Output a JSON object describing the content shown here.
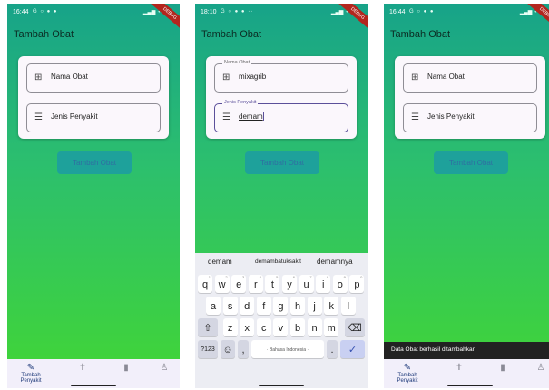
{
  "colors": {
    "accent": "#1ea19b",
    "gradient_top": "#17a389",
    "gradient_bottom": "#3fd33c",
    "nav_active": "#1f3a7a"
  },
  "screens": [
    {
      "status": {
        "time": "16:44",
        "icons": "G ○ ● ●"
      },
      "title": "Tambah Obat",
      "field1": {
        "text": "Nama Obat",
        "icon": "pill-add-icon"
      },
      "field2": {
        "text": "Jenis Penyakit",
        "icon": "note-add-icon"
      },
      "save_button": "Tambah Obat",
      "nav": {
        "active_label": "Tambah Penyakit"
      }
    },
    {
      "status": {
        "time": "18:10",
        "icons": "G ○ ● ● ··"
      },
      "title": "Tambah Obat",
      "field1": {
        "label": "Nama Obat",
        "text": "mixagrib",
        "icon": "pill-add-icon"
      },
      "field2": {
        "label": "Jenis Penyakit",
        "text": "demam",
        "icon": "note-add-icon"
      },
      "save_button": "Tambah Obat",
      "keyboard": {
        "suggestions": [
          "demam",
          "demambatuksakit",
          "demamnya"
        ],
        "row1": [
          "q",
          "w",
          "e",
          "r",
          "t",
          "y",
          "u",
          "i",
          "o",
          "p"
        ],
        "row1_hints": [
          "1",
          "2",
          "3",
          "4",
          "5",
          "6",
          "7",
          "8",
          "9",
          "0"
        ],
        "row2": [
          "a",
          "s",
          "d",
          "f",
          "g",
          "h",
          "j",
          "k",
          "l"
        ],
        "row3": [
          "z",
          "x",
          "c",
          "v",
          "b",
          "n",
          "m"
        ],
        "shift": "⇧",
        "backspace": "⌫",
        "numbers": "?123",
        "emoji": "☺",
        "comma": ",",
        "space": "· Bahasa Indonesia ·",
        "period": ".",
        "enter": "✓"
      }
    },
    {
      "status": {
        "time": "16:44",
        "icons": "G ○ ● ●"
      },
      "title": "Tambah Obat",
      "field1": {
        "text": "Nama Obat",
        "icon": "pill-add-icon"
      },
      "field2": {
        "text": "Jenis Penyakit",
        "icon": "note-add-icon"
      },
      "save_button": "Tambah Obat",
      "snackbar": "Data Obat berhasil ditambahkan",
      "nav": {
        "active_label": "Tambah Penyakit"
      }
    }
  ]
}
